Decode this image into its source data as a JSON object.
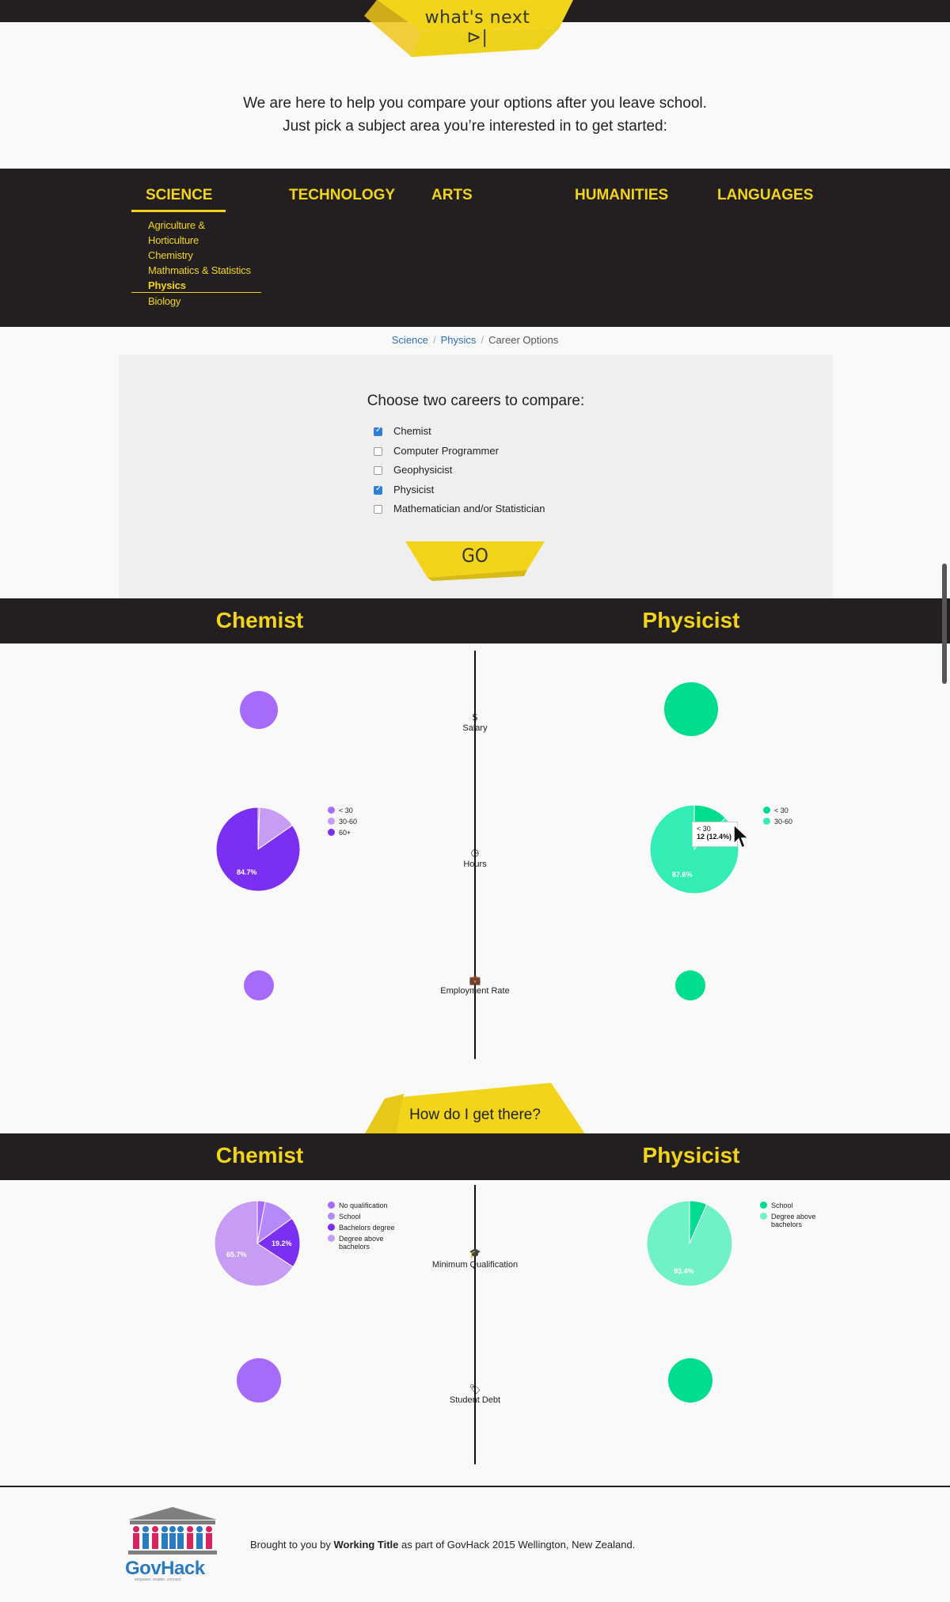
{
  "header": {
    "logo_text": "what's next ⊳|"
  },
  "intro": {
    "line1": "We are here to help you compare your options after you leave school.",
    "line2": "Just pick a subject area you’re interested in to get started:"
  },
  "subjects": {
    "tabs": [
      "SCIENCE",
      "TECHNOLOGY",
      "ARTS",
      "HUMANITIES",
      "LANGUAGES"
    ],
    "active": "SCIENCE",
    "science_items": [
      "Agriculture &",
      "Horticulture",
      "Chemistry",
      "Mathmatics & Statistics",
      "Physics",
      "Biology"
    ],
    "selected_item": "Physics"
  },
  "breadcrumb": {
    "items": [
      "Science",
      "Physics",
      "Career Options"
    ],
    "separator": "/"
  },
  "compare": {
    "title": "Choose two careers to compare:",
    "options": [
      {
        "label": "Chemist",
        "checked": true
      },
      {
        "label": "Computer Programmer",
        "checked": false
      },
      {
        "label": "Geophysicist",
        "checked": false
      },
      {
        "label": "Physicist",
        "checked": true
      },
      {
        "label": "Mathematician and/or Statistician",
        "checked": false
      }
    ],
    "go_label": "GO"
  },
  "comparison": {
    "left": "Chemist",
    "right": "Physicist",
    "metrics": [
      "Salary",
      "Hours",
      "Employment Rate"
    ],
    "metric_icons": [
      "$",
      "◷",
      "💼"
    ]
  },
  "how": {
    "button_label": "How do I get there?",
    "left": "Chemist",
    "right": "Physicist",
    "metrics": [
      "Minimum Qualification",
      "Student Debt"
    ],
    "metric_icons": [
      "🎓",
      "🏷"
    ]
  },
  "colors": {
    "yellow": "#f2d51b",
    "dark": "#231f20",
    "purple": "#a66bfa",
    "purple_dark": "#7b2ff0",
    "purple_light": "#c69cf5",
    "green": "#00dd8e",
    "green_light": "#34edb4",
    "green_pale": "#70f2c6"
  },
  "chart_data": [
    {
      "type": "pie",
      "title": "Chemist Hours",
      "legend": [
        "< 30",
        "30-60",
        "60+"
      ],
      "series": [
        {
          "name": "Hours",
          "values": [
            0.6,
            14.7,
            84.7
          ]
        }
      ],
      "labels_shown": [
        "84.7%"
      ]
    },
    {
      "type": "pie",
      "title": "Physicist Hours",
      "legend": [
        "< 30",
        "30-60"
      ],
      "series": [
        {
          "name": "Hours",
          "values": [
            12.4,
            87.6
          ]
        }
      ],
      "labels_shown": [
        "87.6%"
      ],
      "tooltip": {
        "category": "< 30",
        "value": "12 (12.4%)"
      }
    },
    {
      "type": "pie",
      "title": "Chemist Minimum Qualification",
      "legend": [
        "No qualification",
        "School",
        "Bachelors degree",
        "Degree above bachelors"
      ],
      "series": [
        {
          "name": "Minimum Qualification",
          "values": [
            3.0,
            12.0,
            19.2,
            65.7
          ]
        }
      ],
      "labels_shown": [
        "19.2%",
        "65.7%"
      ]
    },
    {
      "type": "pie",
      "title": "Physicist Minimum Qualification",
      "legend": [
        "School",
        "Degree above bachelors"
      ],
      "series": [
        {
          "name": "Minimum Qualification",
          "values": [
            6.6,
            93.4
          ]
        }
      ],
      "labels_shown": [
        "93.4%"
      ]
    }
  ],
  "footer": {
    "text_prefix": "Brought to you by ",
    "text_bold": "Working Title",
    "text_suffix": " as part of GovHack 2015 Wellington, New Zealand.",
    "logo_text": "GovHack",
    "logo_tagline": "empower. enable. connect"
  }
}
